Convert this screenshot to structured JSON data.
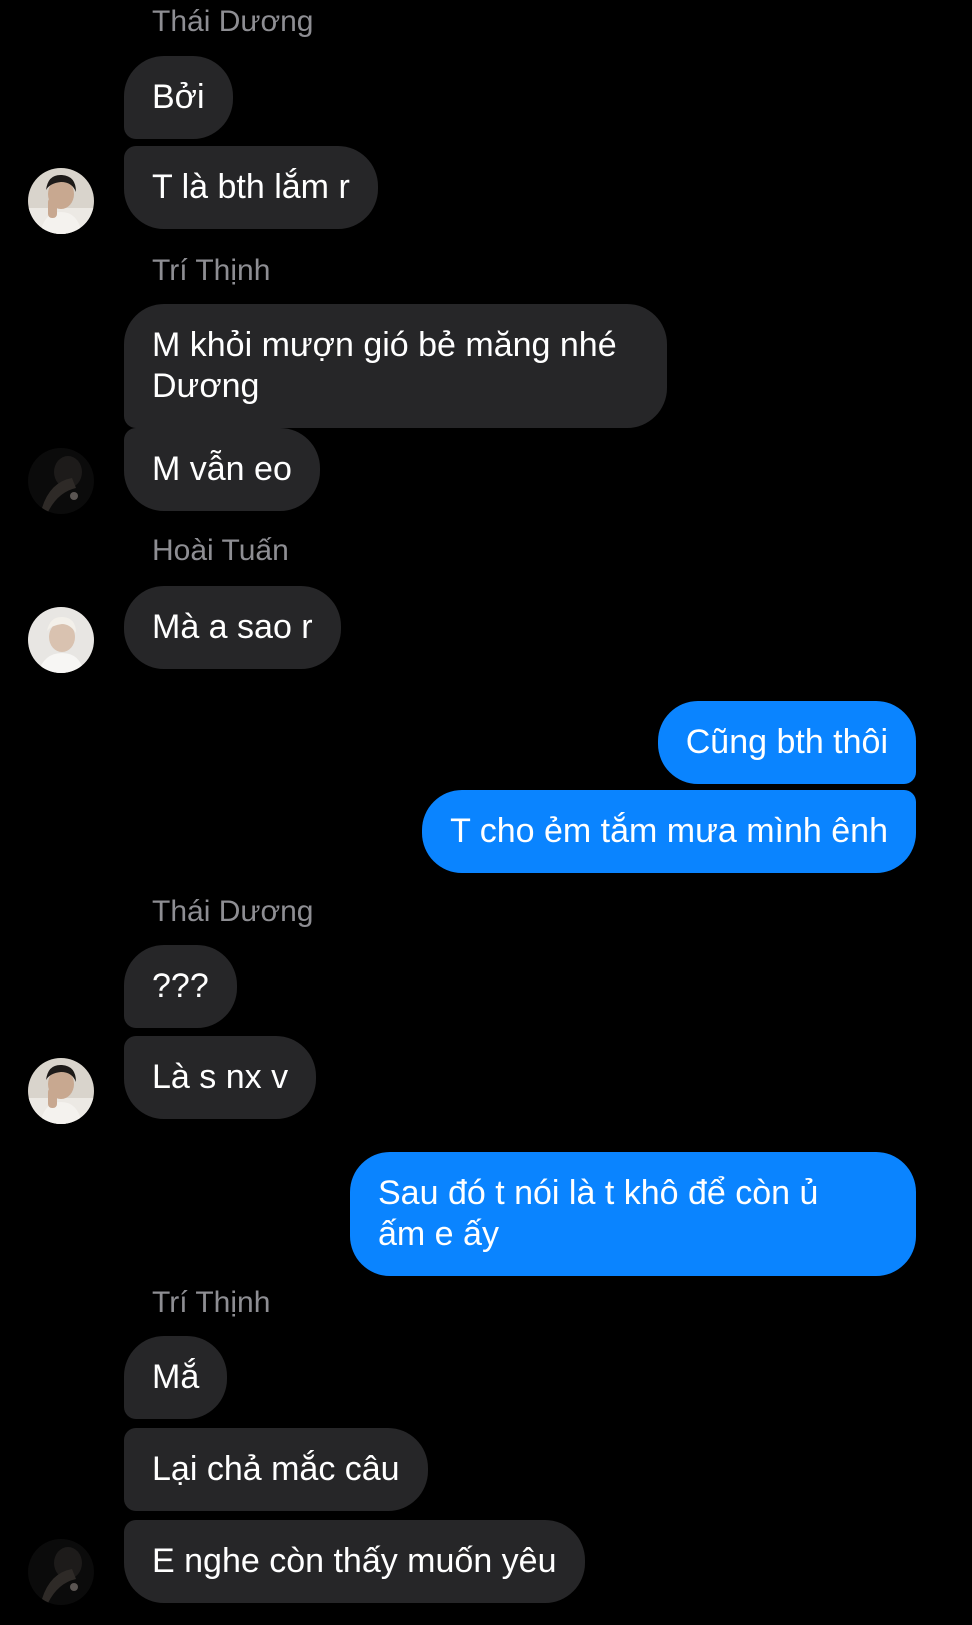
{
  "messages": [
    {
      "sender": "Thái Dương",
      "text": "Bởi"
    },
    {
      "sender": "Thái Dương",
      "text": "T là bth lắm r"
    },
    {
      "sender": "Trí Thịnh",
      "text": "M khỏi mượn gió bẻ măng nhé\nDương"
    },
    {
      "sender": "Trí Thịnh",
      "text": "M vẫn eo"
    },
    {
      "sender": "Hoài Tuấn",
      "text": "Mà a sao r"
    },
    {
      "sender": "me",
      "text": "Cũng bth thôi"
    },
    {
      "sender": "me",
      "text": "T cho ẻm tắm mưa mình ênh"
    },
    {
      "sender": "Thái Dương",
      "text": "???"
    },
    {
      "sender": "Thái Dương",
      "text": "Là s nx v"
    },
    {
      "sender": "me",
      "text": "Sau đó t nói là t khô để còn ủ\nấm e ấy"
    },
    {
      "sender": "Trí Thịnh",
      "text": "Mắ"
    },
    {
      "sender": "Trí Thịnh",
      "text": "Lại chả mắc câu"
    },
    {
      "sender": "Trí Thịnh",
      "text": "E nghe còn thấy muốn yêu"
    }
  ],
  "senders": {
    "thai_duong": "Thái Dương",
    "tri_thinh": "Trí Thịnh",
    "hoai_tuan": "Hoài Tuấn"
  },
  "colors": {
    "background": "#000000",
    "incoming_bubble": "#262628",
    "outgoing_bubble": "#0a84ff",
    "sender_name": "#8e8e93"
  }
}
